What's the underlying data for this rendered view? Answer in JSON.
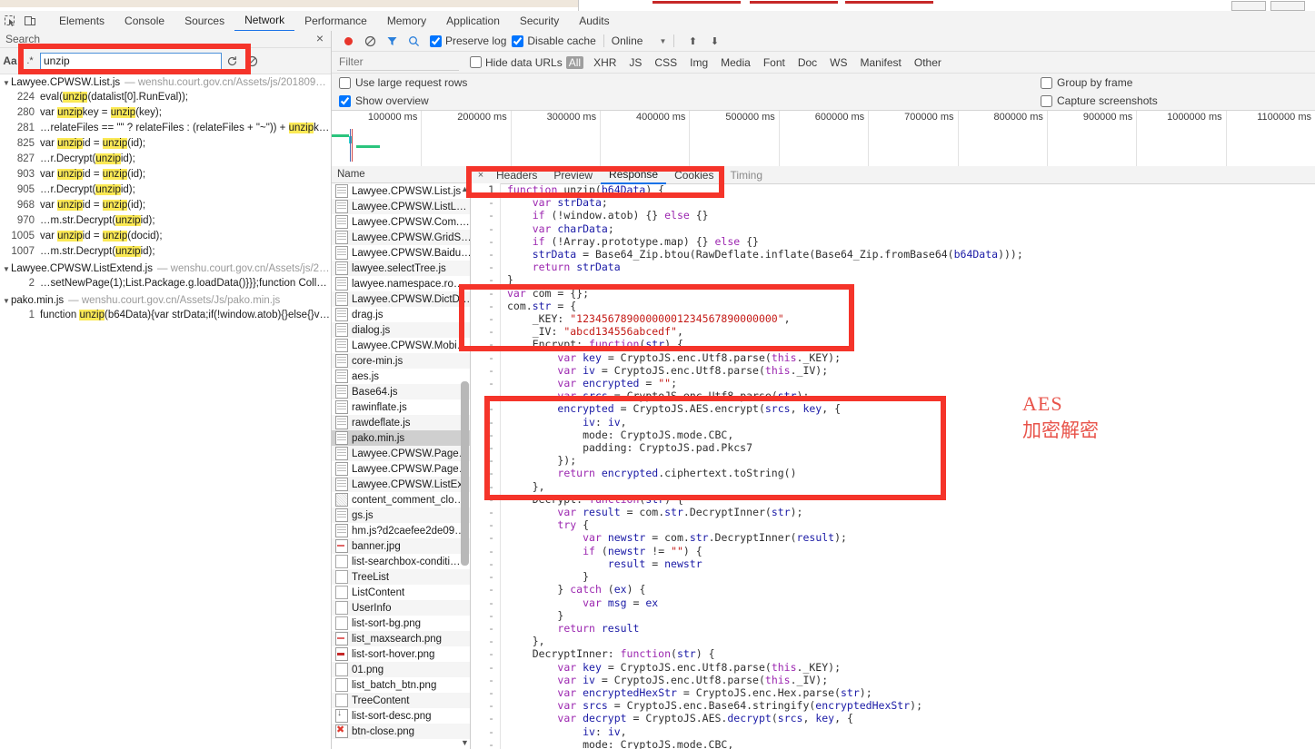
{
  "devtools": {
    "icons": [
      "inspect-element-icon",
      "device-toolbar-icon"
    ],
    "tabs": [
      {
        "label": "Elements",
        "selected": false
      },
      {
        "label": "Console",
        "selected": false
      },
      {
        "label": "Sources",
        "selected": false
      },
      {
        "label": "Network",
        "selected": true
      },
      {
        "label": "Performance",
        "selected": false
      },
      {
        "label": "Memory",
        "selected": false
      },
      {
        "label": "Application",
        "selected": false
      },
      {
        "label": "Security",
        "selected": false
      },
      {
        "label": "Audits",
        "selected": false
      }
    ]
  },
  "search": {
    "panel_title": "Search",
    "close_label": "×",
    "case_toggle": "Aa",
    "regex_toggle": ".*",
    "query_value": "unzip",
    "query_placeholder": "",
    "refresh_icon": "↻",
    "clear_icon": "⊘",
    "highlight_term": "unzip",
    "groups": [
      {
        "file": "Lawyee.CPWSW.List.js",
        "url": "— wenshu.court.gov.cn/Assets/js/2018091…",
        "matches": [
          {
            "line": "224",
            "text": "eval(unzip(datalist[0].RunEval));"
          },
          {
            "line": "280",
            "text": "var unzipkey = unzip(key);"
          },
          {
            "line": "281",
            "text": "…relateFiles == \"\" ? relateFiles : (relateFiles + \"~\")) + unzipke…"
          },
          {
            "line": "825",
            "text": "var unzipid = unzip(id);"
          },
          {
            "line": "827",
            "text": "…r.Decrypt(unzipid);"
          },
          {
            "line": "903",
            "text": "var unzipid = unzip(id);"
          },
          {
            "line": "905",
            "text": "…r.Decrypt(unzipid);"
          },
          {
            "line": "968",
            "text": "var unzipid = unzip(id);"
          },
          {
            "line": "970",
            "text": "…m.str.Decrypt(unzipid);"
          },
          {
            "line": "1005",
            "text": "var unzipid = unzip(docid);"
          },
          {
            "line": "1007",
            "text": "…m.str.Decrypt(unzipid);"
          }
        ]
      },
      {
        "file": "Lawyee.CPWSW.ListExtend.js",
        "url": "— wenshu.court.gov.cn/Assets/js/20…",
        "matches": [
          {
            "line": "2",
            "text": "…setNewPage(1);List.Package.g.loadData()}}};function CollectCa…"
          }
        ]
      },
      {
        "file": "pako.min.js",
        "url": "— wenshu.court.gov.cn/Assets/Js/pako.min.js",
        "matches": [
          {
            "line": "1",
            "text": "function unzip(b64Data){var strData;if(!window.atob){}else{}var …"
          }
        ]
      }
    ]
  },
  "network": {
    "toolbar": {
      "record_icon": "record-icon",
      "clear_icon": "clear-icon",
      "filter_icon": "filter-funnel-icon",
      "search_icon": "search-icon",
      "preserve_log": {
        "label": "Preserve log",
        "checked": true
      },
      "disable_cache": {
        "label": "Disable cache",
        "checked": true
      },
      "throttling": "Online",
      "import_icon": "import-har-icon",
      "export_icon": "export-har-icon"
    },
    "filterbar": {
      "filter_placeholder": "Filter",
      "filter_value": "",
      "hide_data_urls": {
        "label": "Hide data URLs",
        "checked": false
      },
      "types": [
        "All",
        "XHR",
        "JS",
        "CSS",
        "Img",
        "Media",
        "Font",
        "Doc",
        "WS",
        "Manifest",
        "Other"
      ],
      "selected_type": "All"
    },
    "options": {
      "large_rows": {
        "label": "Use large request rows",
        "checked": false
      },
      "show_overview": {
        "label": "Show overview",
        "checked": true
      },
      "group_by_frame": {
        "label": "Group by frame",
        "checked": false
      },
      "capture_screenshots": {
        "label": "Capture screenshots",
        "checked": false
      }
    },
    "overview_ticks": [
      "100000 ms",
      "200000 ms",
      "300000 ms",
      "400000 ms",
      "500000 ms",
      "600000 ms",
      "700000 ms",
      "800000 ms",
      "900000 ms",
      "1000000 ms",
      "1100000 ms"
    ],
    "list": {
      "column_header": "Name",
      "selected": "pako.min.js",
      "rows": [
        {
          "name": "Lawyee.CPWSW.List.js",
          "icon": "js"
        },
        {
          "name": "Lawyee.CPWSW.ListL…",
          "icon": "js"
        },
        {
          "name": "Lawyee.CPWSW.Com.…",
          "icon": "js"
        },
        {
          "name": "Lawyee.CPWSW.GridS…",
          "icon": "js"
        },
        {
          "name": "Lawyee.CPWSW.Baidu…",
          "icon": "js"
        },
        {
          "name": "lawyee.selectTree.js",
          "icon": "js"
        },
        {
          "name": "lawyee.namespace.ro…",
          "icon": "js"
        },
        {
          "name": "Lawyee.CPWSW.DictD…",
          "icon": "js"
        },
        {
          "name": "drag.js",
          "icon": "js"
        },
        {
          "name": "dialog.js",
          "icon": "js"
        },
        {
          "name": "Lawyee.CPWSW.Mobi…",
          "icon": "js"
        },
        {
          "name": "core-min.js",
          "icon": "js"
        },
        {
          "name": "aes.js",
          "icon": "js"
        },
        {
          "name": "Base64.js",
          "icon": "js"
        },
        {
          "name": "rawinflate.js",
          "icon": "js"
        },
        {
          "name": "rawdeflate.js",
          "icon": "js"
        },
        {
          "name": "pako.min.js",
          "icon": "js"
        },
        {
          "name": "Lawyee.CPWSW.Page…",
          "icon": "js"
        },
        {
          "name": "Lawyee.CPWSW.Page…",
          "icon": "js"
        },
        {
          "name": "Lawyee.CPWSW.ListEx…",
          "icon": "js"
        },
        {
          "name": "content_comment_clo…",
          "icon": "hatch"
        },
        {
          "name": "gs.js",
          "icon": "js"
        },
        {
          "name": "hm.js?d2caefee2de09…",
          "icon": "js"
        },
        {
          "name": "banner.jpg",
          "icon": "img"
        },
        {
          "name": "list-searchbox-conditi…",
          "icon": "doc"
        },
        {
          "name": "TreeList",
          "icon": "doc"
        },
        {
          "name": "ListContent",
          "icon": "doc"
        },
        {
          "name": "UserInfo",
          "icon": "doc"
        },
        {
          "name": "list-sort-bg.png",
          "icon": "doc"
        },
        {
          "name": "list_maxsearch.png",
          "icon": "img"
        },
        {
          "name": "list-sort-hover.png",
          "icon": "imgb"
        },
        {
          "name": "01.png",
          "icon": "doc"
        },
        {
          "name": "list_batch_btn.png",
          "icon": "doc"
        },
        {
          "name": "TreeContent",
          "icon": "doc"
        },
        {
          "name": "list-sort-desc.png",
          "icon": "dl"
        },
        {
          "name": "btn-close.png",
          "icon": "cl"
        }
      ]
    },
    "detail": {
      "close_label": "×",
      "tabs": [
        {
          "label": "Headers",
          "selected": false
        },
        {
          "label": "Preview",
          "selected": false
        },
        {
          "label": "Response",
          "selected": true
        },
        {
          "label": "Cookies",
          "selected": false
        },
        {
          "label": "Timing",
          "selected": false
        }
      ],
      "code_lines": [
        {
          "n": "1",
          "t": "function unzip(b64Data) {"
        },
        {
          "n": "-",
          "t": "    var strData;"
        },
        {
          "n": "-",
          "t": "    if (!window.atob) {} else {}"
        },
        {
          "n": "-",
          "t": "    var charData;"
        },
        {
          "n": "-",
          "t": "    if (!Array.prototype.map) {} else {}"
        },
        {
          "n": "-",
          "t": "    strData = Base64_Zip.btou(RawDeflate.inflate(Base64_Zip.fromBase64(b64Data)));"
        },
        {
          "n": "-",
          "t": "    return strData"
        },
        {
          "n": "-",
          "t": "}"
        },
        {
          "n": "-",
          "t": "var com = {};"
        },
        {
          "n": "-",
          "t": "com.str = {"
        },
        {
          "n": "-",
          "t": "    _KEY: \"12345678900000001234567890000000\","
        },
        {
          "n": "-",
          "t": "    _IV: \"abcd134556abcedf\","
        },
        {
          "n": "-",
          "t": "    Encrypt: function(str) {"
        },
        {
          "n": "-",
          "t": "        var key = CryptoJS.enc.Utf8.parse(this._KEY);"
        },
        {
          "n": "-",
          "t": "        var iv = CryptoJS.enc.Utf8.parse(this._IV);"
        },
        {
          "n": "-",
          "t": "        var encrypted = \"\";"
        },
        {
          "n": "-",
          "t": "        var srcs = CryptoJS.enc.Utf8.parse(str);"
        },
        {
          "n": "-",
          "t": "        encrypted = CryptoJS.AES.encrypt(srcs, key, {"
        },
        {
          "n": "-",
          "t": "            iv: iv,"
        },
        {
          "n": "-",
          "t": "            mode: CryptoJS.mode.CBC,"
        },
        {
          "n": "-",
          "t": "            padding: CryptoJS.pad.Pkcs7"
        },
        {
          "n": "-",
          "t": "        });"
        },
        {
          "n": "-",
          "t": "        return encrypted.ciphertext.toString()"
        },
        {
          "n": "-",
          "t": "    },"
        },
        {
          "n": "-",
          "t": "    Decrypt: function(str) {"
        },
        {
          "n": "-",
          "t": "        var result = com.str.DecryptInner(str);"
        },
        {
          "n": "-",
          "t": "        try {"
        },
        {
          "n": "-",
          "t": "            var newstr = com.str.DecryptInner(result);"
        },
        {
          "n": "-",
          "t": "            if (newstr != \"\") {"
        },
        {
          "n": "-",
          "t": "                result = newstr"
        },
        {
          "n": "-",
          "t": "            }"
        },
        {
          "n": "-",
          "t": "        } catch (ex) {"
        },
        {
          "n": "-",
          "t": "            var msg = ex"
        },
        {
          "n": "-",
          "t": "        }"
        },
        {
          "n": "-",
          "t": "        return result"
        },
        {
          "n": "-",
          "t": "    },"
        },
        {
          "n": "-",
          "t": "    DecryptInner: function(str) {"
        },
        {
          "n": "-",
          "t": "        var key = CryptoJS.enc.Utf8.parse(this._KEY);"
        },
        {
          "n": "-",
          "t": "        var iv = CryptoJS.enc.Utf8.parse(this._IV);"
        },
        {
          "n": "-",
          "t": "        var encryptedHexStr = CryptoJS.enc.Hex.parse(str);"
        },
        {
          "n": "-",
          "t": "        var srcs = CryptoJS.enc.Base64.stringify(encryptedHexStr);"
        },
        {
          "n": "-",
          "t": "        var decrypt = CryptoJS.AES.decrypt(srcs, key, {"
        },
        {
          "n": "-",
          "t": "            iv: iv,"
        },
        {
          "n": "-",
          "t": "            mode: CryptoJS.mode.CBC,"
        }
      ]
    }
  },
  "annotation": {
    "line1": "AES",
    "line2": "加密解密",
    "color": "#e8534a",
    "box_color": "#f5342a"
  }
}
